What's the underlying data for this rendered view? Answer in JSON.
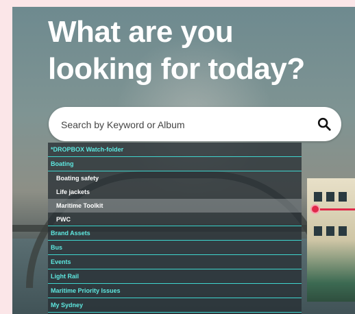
{
  "hero": {
    "title_line1": "What are you",
    "title_line2": "looking for today?"
  },
  "search": {
    "placeholder": "Search by Keyword or Album",
    "icon": "search-icon"
  },
  "dropdown": {
    "items": [
      {
        "label": "*DROPBOX Watch-folder",
        "type": "category"
      },
      {
        "label": "Boating",
        "type": "category"
      },
      {
        "label": "Boating safety",
        "type": "sub"
      },
      {
        "label": "Life jackets",
        "type": "sub"
      },
      {
        "label": "Maritime Toolkit",
        "type": "sub",
        "highlighted": true
      },
      {
        "label": "PWC",
        "type": "sub"
      },
      {
        "label": "Brand Assets",
        "type": "category"
      },
      {
        "label": "Bus",
        "type": "category"
      },
      {
        "label": "Events",
        "type": "category"
      },
      {
        "label": "Light Rail",
        "type": "category"
      },
      {
        "label": "Maritime Priority Issues",
        "type": "category"
      },
      {
        "label": "My Sydney",
        "type": "category"
      }
    ]
  },
  "colors": {
    "accent": "#5ee8e0",
    "handle": "#e0294a",
    "background": "#fbe6e8"
  }
}
